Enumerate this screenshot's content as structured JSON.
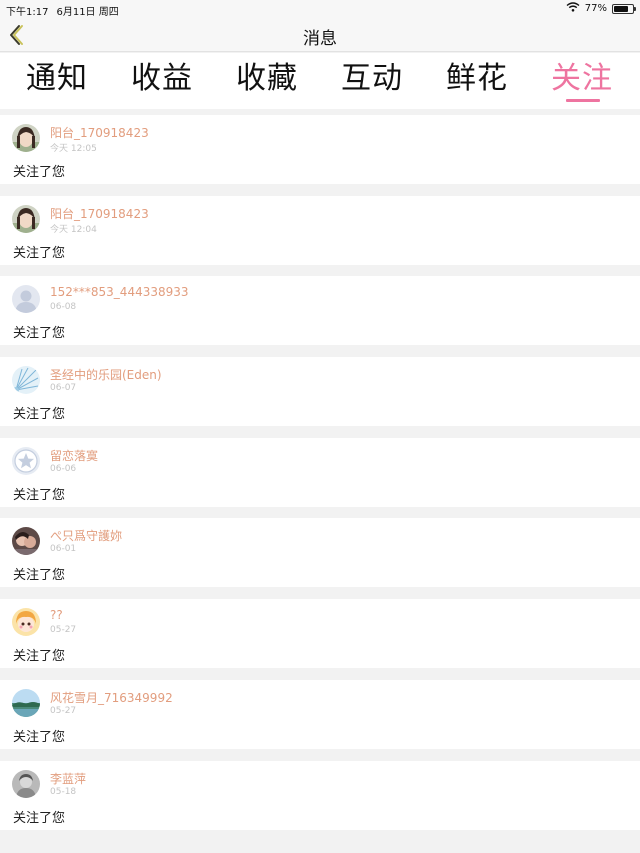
{
  "status": {
    "time": "下午1:17",
    "date": "6月11日 周四",
    "battery_text": "77%",
    "battery_level": 0.77,
    "wifi_icon": "wifi-icon"
  },
  "nav": {
    "title": "消息",
    "back_icon": "chevron-left-icon"
  },
  "tabs": [
    {
      "label": "通知",
      "active": false
    },
    {
      "label": "收益",
      "active": false
    },
    {
      "label": "收藏",
      "active": false
    },
    {
      "label": "互动",
      "active": false
    },
    {
      "label": "鲜花",
      "active": false
    },
    {
      "label": "关注",
      "active": true
    }
  ],
  "accent_color": "#ee74a0",
  "username_color": "#e29d7e",
  "items": [
    {
      "name": "阳台_170918423",
      "time": "今天 12:05",
      "message": "关注了您",
      "avatar": "portrait-photo"
    },
    {
      "name": "阳台_170918423",
      "time": "今天 12:04",
      "message": "关注了您",
      "avatar": "portrait-photo"
    },
    {
      "name": "152***853_444338933",
      "time": "06-08",
      "message": "关注了您",
      "avatar": "default-user"
    },
    {
      "name": "圣经中的乐园(Eden)",
      "time": "06-07",
      "message": "关注了您",
      "avatar": "blue-fan"
    },
    {
      "name": "留恋落寞",
      "time": "06-06",
      "message": "关注了您",
      "avatar": "star-badge"
    },
    {
      "name": "ぺ只爲守護妳",
      "time": "06-01",
      "message": "关注了您",
      "avatar": "couple-photo"
    },
    {
      "name": "??",
      "time": "05-27",
      "message": "关注了您",
      "avatar": "cartoon-girl"
    },
    {
      "name": "风花雪月_716349992",
      "time": "05-27",
      "message": "关注了您",
      "avatar": "landscape"
    },
    {
      "name": "李蓝萍",
      "time": "05-18",
      "message": "关注了您",
      "avatar": "gray-portrait"
    }
  ]
}
